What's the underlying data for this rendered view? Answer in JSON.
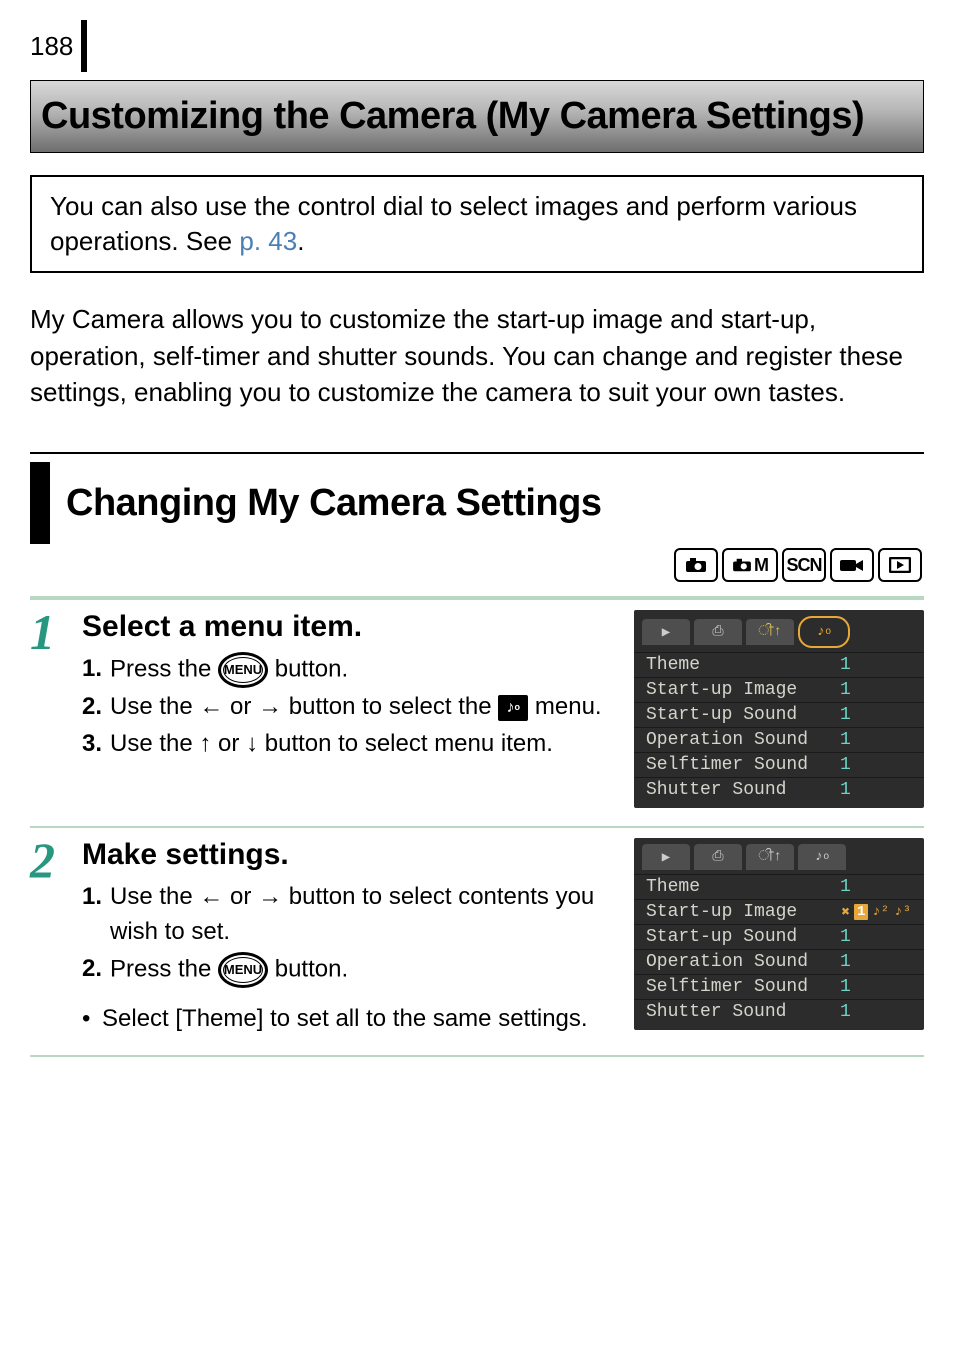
{
  "page_number": "188",
  "title": "Customizing the Camera (My Camera Settings)",
  "note": {
    "text_before_link": "You can also use the control dial to select images and perform various operations. See ",
    "link_text": "p. 43",
    "text_after_link": "."
  },
  "intro": "My Camera allows you to customize the start-up image and start-up, operation, self-timer and shutter sounds. You can change and register these settings, enabling you to customize the camera to suit your own tastes.",
  "section_title": "Changing My Camera Settings",
  "mode_icons": [
    "camera-auto",
    "camera-manual",
    "SCN",
    "movie",
    "playback"
  ],
  "steps": [
    {
      "number": "1",
      "title": "Select a menu item.",
      "lines": [
        {
          "num": "1.",
          "before": "Press the ",
          "icon": "menu-button",
          "after": " button."
        },
        {
          "num": "2.",
          "before": "Use the ",
          "arrow1": "←",
          "mid": " or ",
          "arrow2": "→",
          "after": " button to select the ",
          "icon2": "my-camera-icon",
          "after2": " menu."
        },
        {
          "num": "3.",
          "before": "Use the ",
          "arrow1": "↑",
          "mid": " or ",
          "arrow2": "↓",
          "after": " button to select menu item."
        }
      ],
      "screen": {
        "active_tab_style": "orange-ring",
        "rows": [
          {
            "label": "Theme",
            "value": "1"
          },
          {
            "label": "Start-up Image",
            "value": "1"
          },
          {
            "label": "Start-up Sound",
            "value": "1"
          },
          {
            "label": "Operation Sound",
            "value": "1"
          },
          {
            "label": "Selftimer Sound",
            "value": "1"
          },
          {
            "label": "Shutter Sound",
            "value": "1"
          }
        ]
      }
    },
    {
      "number": "2",
      "title": "Make settings.",
      "lines": [
        {
          "num": "1.",
          "before": "Use the ",
          "arrow1": "←",
          "mid": " or ",
          "arrow2": "→",
          "after": " button to select contents you wish to set."
        },
        {
          "num": "2.",
          "before": "Press the ",
          "icon": "menu-button",
          "after": " button."
        }
      ],
      "bullet": "Select [Theme] to set all to the same settings.",
      "screen": {
        "active_tab_style": "plain",
        "selected_row_index": 1,
        "rows": [
          {
            "label": "Theme",
            "value": "1"
          },
          {
            "label": "Start-up Image",
            "value_options": [
              "off",
              "1",
              "2",
              "3"
            ],
            "value_selected_index": 1
          },
          {
            "label": "Start-up Sound",
            "value": "1"
          },
          {
            "label": "Operation Sound",
            "value": "1"
          },
          {
            "label": "Selftimer Sound",
            "value": "1"
          },
          {
            "label": "Shutter Sound",
            "value": "1"
          }
        ]
      }
    }
  ]
}
